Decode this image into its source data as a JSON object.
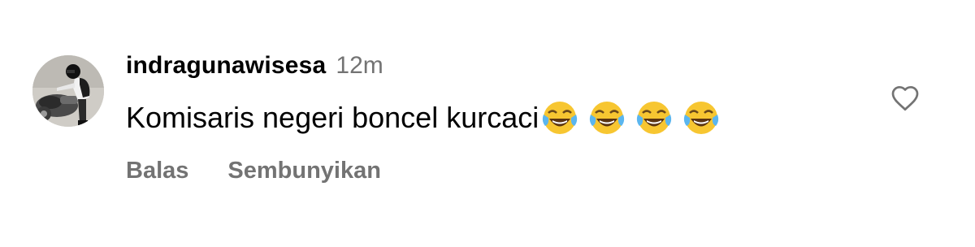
{
  "comment": {
    "username": "indragunawisesa",
    "time_ago": "12m",
    "text": "Komisaris negeri boncel kurcaci",
    "emojis": [
      "😂",
      "😂",
      "😂",
      "😂"
    ],
    "emoji_icon": "face-with-tears-of-joy-icon",
    "avatar_icon": "profile-photo-person-on-motorcycle"
  },
  "actions": {
    "reply_label": "Balas",
    "hide_label": "Sembunyikan"
  },
  "like": {
    "icon": "heart-outline-icon"
  },
  "colors": {
    "primary_text": "#000000",
    "secondary_text": "#737373",
    "background": "#ffffff"
  }
}
